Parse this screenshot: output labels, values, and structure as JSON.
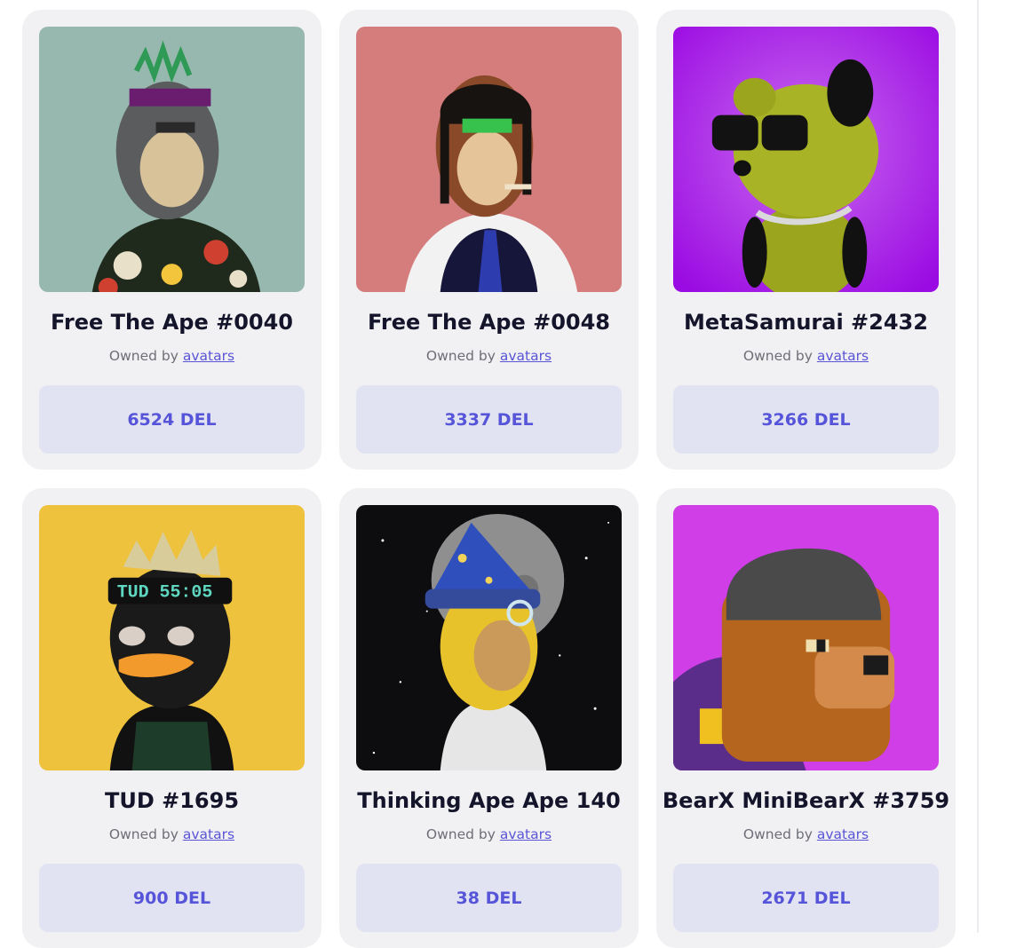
{
  "owned_by_label": "Owned by",
  "cards": [
    {
      "title": "Free The Ape #0040",
      "owner": "avatars",
      "price": "6524 DEL",
      "bg": "#96b8ae",
      "image": "ape-avatar"
    },
    {
      "title": "Free The Ape #0048",
      "owner": "avatars",
      "price": "3337 DEL",
      "bg": "#d57c7c",
      "image": "ape-avatar"
    },
    {
      "title": "MetaSamurai #2432",
      "owner": "avatars",
      "price": "3266 DEL",
      "bg": "#a30fe6",
      "image": "bear-avatar"
    },
    {
      "title": "TUD #1695",
      "owner": "avatars",
      "price": "900 DEL",
      "bg": "#eec23d",
      "image": "duck-avatar"
    },
    {
      "title": "Thinking Ape Ape 140",
      "owner": "avatars",
      "price": "38 DEL",
      "bg": "#0d0d10",
      "image": "wizard-ape-avatar"
    },
    {
      "title": "BearX MiniBearX #3759",
      "owner": "avatars",
      "price": "2671 DEL",
      "bg": "#cf3ee6",
      "image": "pixel-bear-avatar"
    }
  ],
  "colors": {
    "card_bg": "#f1f1f3",
    "price_bg": "#e1e3f2",
    "price_text": "#5654d9",
    "link": "#5a55d6"
  }
}
